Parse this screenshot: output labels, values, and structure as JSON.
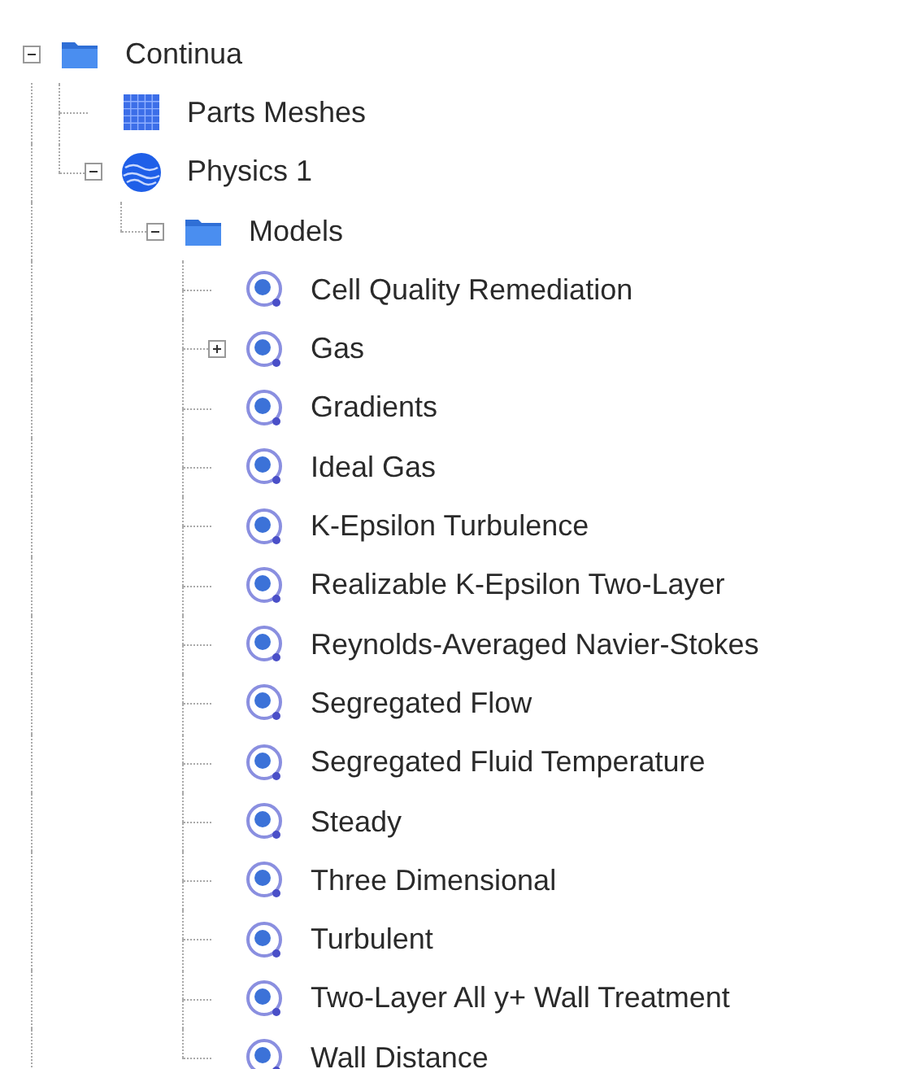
{
  "tree": [
    {
      "label": "Continua",
      "kind": "folder",
      "expanded": true,
      "children": [
        {
          "label": "Parts Meshes",
          "kind": "mesh"
        },
        {
          "label": "Physics 1",
          "kind": "physics",
          "expanded": true,
          "children": [
            {
              "label": "Models",
              "kind": "folder",
              "expanded": true,
              "children": [
                {
                  "label": "Cell Quality Remediation",
                  "kind": "model"
                },
                {
                  "label": "Gas",
                  "kind": "model",
                  "expanded": false
                },
                {
                  "label": "Gradients",
                  "kind": "model"
                },
                {
                  "label": "Ideal Gas",
                  "kind": "model"
                },
                {
                  "label": "K-Epsilon Turbulence",
                  "kind": "model"
                },
                {
                  "label": "Realizable K-Epsilon Two-Layer",
                  "kind": "model"
                },
                {
                  "label": "Reynolds-Averaged Navier-Stokes",
                  "kind": "model"
                },
                {
                  "label": "Segregated Flow",
                  "kind": "model"
                },
                {
                  "label": "Segregated Fluid Temperature",
                  "kind": "model"
                },
                {
                  "label": "Steady",
                  "kind": "model"
                },
                {
                  "label": "Three Dimensional",
                  "kind": "model"
                },
                {
                  "label": "Turbulent",
                  "kind": "model"
                },
                {
                  "label": "Two-Layer All y+ Wall Treatment",
                  "kind": "model"
                },
                {
                  "label": "Wall Distance",
                  "kind": "model"
                }
              ]
            }
          ]
        }
      ]
    }
  ]
}
